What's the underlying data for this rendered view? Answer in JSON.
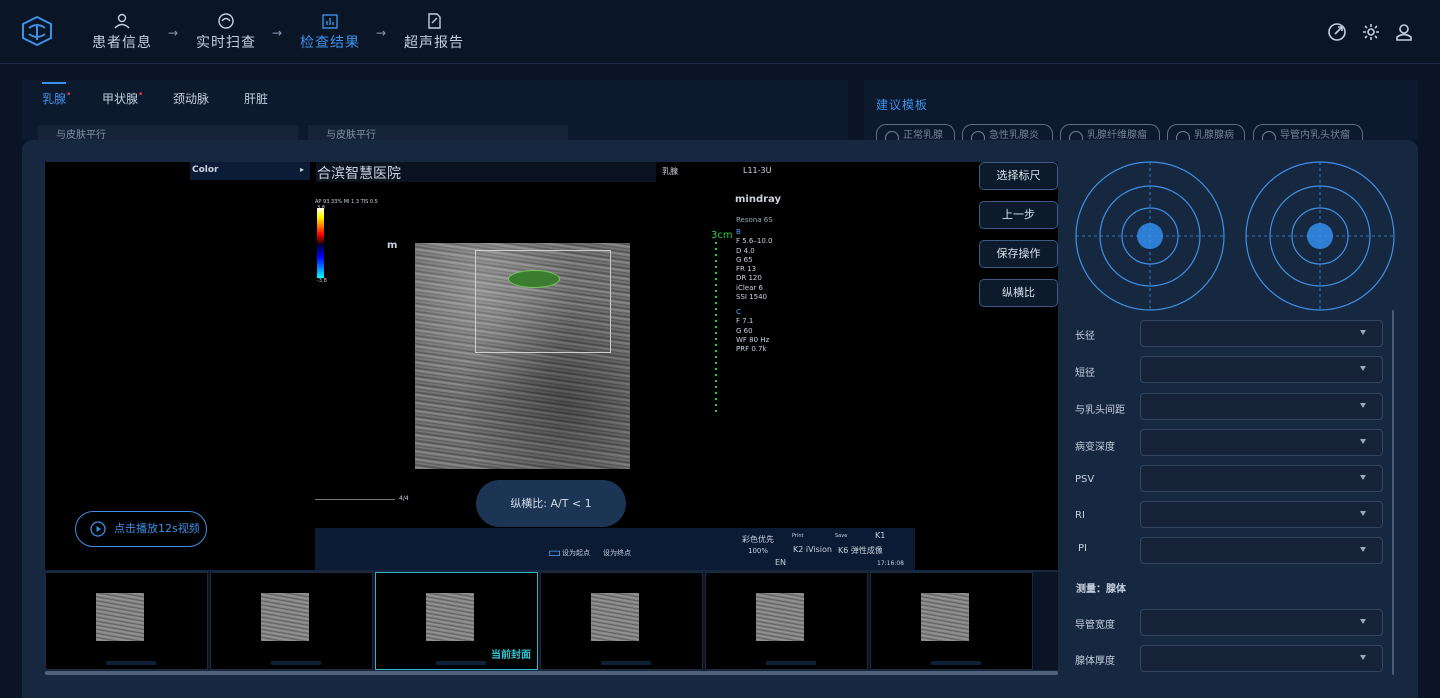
{
  "header": {
    "steps": [
      {
        "label": "患者信息",
        "active": false
      },
      {
        "label": "实时扫查",
        "active": false
      },
      {
        "label": "检查结果",
        "active": true
      },
      {
        "label": "超声报告",
        "active": false
      }
    ],
    "arrow": "→",
    "accent_color": "#3e8fe6"
  },
  "tabs": [
    {
      "label": "乳腺",
      "active": true,
      "flag": "•"
    },
    {
      "label": "甲状腺",
      "active": false,
      "flag": "•"
    },
    {
      "label": "颈动脉",
      "active": false,
      "flag": ""
    },
    {
      "label": "肝脏",
      "active": false,
      "flag": ""
    }
  ],
  "subcards": [
    "与皮肤平行",
    "与皮肤平行"
  ],
  "suggest": {
    "title": "建议模板",
    "options": [
      "正常乳腺",
      "急性乳腺炎",
      "乳腺纤维腺瘤",
      "乳腺腺病",
      "导管内乳头状瘤"
    ]
  },
  "viewer": {
    "color_menu": "Color",
    "color_menu_caret": "▸",
    "hospital": "合滨智慧医院",
    "exam_tag": "乳腺",
    "probe": "L11-3U",
    "brand": "mindray",
    "model": "Resona 6S",
    "ap_line": "AP 93.33%  MI 1.3  TIS 0.5",
    "scale_top": "3.8",
    "scale_bottom": "-3.8",
    "m_marker": "m",
    "depth_label": "3cm",
    "params_b": [
      "B",
      "F 5.6–10.0",
      "D 4.0",
      "G 65",
      "FR 13",
      "DR 120",
      "iClear 6",
      "SSI 1540"
    ],
    "params_c": [
      "C",
      "F 7.1",
      "G 60",
      "WF 80 Hz",
      "PRF 0.7k"
    ],
    "cine_counter": "4/4",
    "priority": "彩色优先",
    "percent": "100%",
    "k_labels": [
      "K2 iVision",
      "K6 弹性成像",
      "K1"
    ],
    "small_tags": [
      "Print",
      "Save"
    ],
    "lang": "EN",
    "time": "17:16:08",
    "set_start": "设为起点",
    "set_end": "设为终点",
    "ratio_pill": "纵横比: A/T < 1",
    "play_label": "点击播放12s视频"
  },
  "viewer_buttons": [
    "选择标尺",
    "上一步",
    "保存操作",
    "纵横比"
  ],
  "thumbnails": {
    "count": 6,
    "selected_index": 2,
    "cover_label": "当前封面",
    "thumb_hospital": "合滨智慧医院"
  },
  "form": {
    "fields": [
      {
        "label": "长径",
        "value": ""
      },
      {
        "label": "短径",
        "value": ""
      },
      {
        "label": "与乳头间距",
        "value": ""
      },
      {
        "label": "病变深度",
        "value": ""
      },
      {
        "label": "PSV",
        "value": ""
      },
      {
        "label": "RI",
        "value": ""
      },
      {
        "label": "PI",
        "value": ""
      }
    ],
    "section_note": "测量：腺体",
    "fields2": [
      {
        "label": "导管宽度",
        "value": ""
      },
      {
        "label": "腺体厚度",
        "value": ""
      }
    ]
  }
}
